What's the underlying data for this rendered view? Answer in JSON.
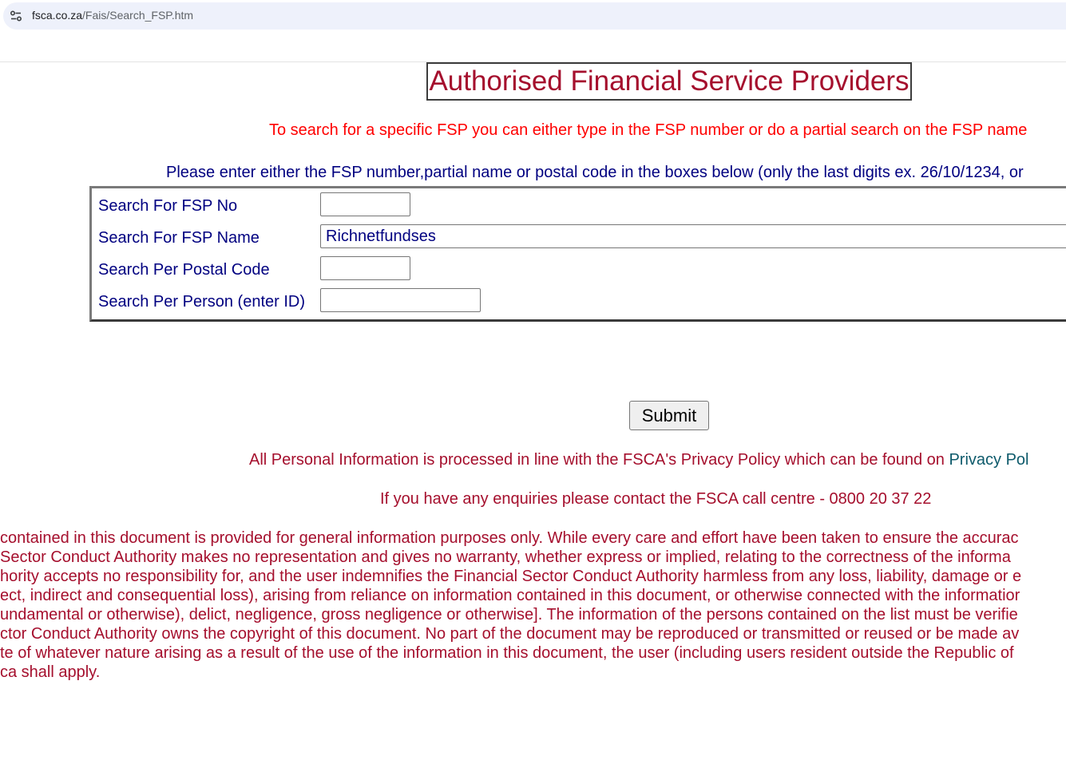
{
  "browser": {
    "url_host": "fsca.co.za",
    "url_path": "/Fais/Search_FSP.htm",
    "site_info_icon": "tune-icon"
  },
  "page": {
    "title": "Authorised Financial Service Providers",
    "instruction_red": "To search for a specific FSP you can either type in the FSP number or do a partial search on the FSP name",
    "instruction_blue": "Please enter either the FSP number,partial name or postal code in the boxes below (only the last digits ex. 26/10/1234, or"
  },
  "search_form": {
    "fsp_no": {
      "label": "Search For FSP No",
      "value": ""
    },
    "fsp_name": {
      "label": "Search For FSP Name",
      "value": "Richnetfundses"
    },
    "postal_code": {
      "label": "Search Per Postal Code",
      "value": ""
    },
    "person_id": {
      "label": "Search Per Person (enter ID)",
      "value": ""
    },
    "submit_label": "Submit"
  },
  "footer": {
    "privacy_text": "All Personal Information is processed in line with the FSCA's Privacy Policy which can be found on ",
    "privacy_link": "Privacy Pol",
    "enquiry_text": "If you have any enquiries please contact the FSCA call centre - 0800 20 37 22",
    "disclaimer_lines": [
      " contained in this document is provided for general information purposes only. While every care and effort have been taken to ensure the accurac",
      " Sector Conduct Authority makes no representation and gives no warranty, whether express or implied, relating to the correctness of the informa",
      "hority accepts no responsibility for, and the user indemnifies the Financial Sector Conduct Authority harmless from any loss, liability, damage or e",
      "ect, indirect and consequential loss), arising from reliance on information contained in this document, or otherwise connected with the informatior",
      "undamental or otherwise), delict, negligence, gross negligence or otherwise]. The information of the persons contained on the list must be verifie",
      "ctor Conduct Authority owns the copyright of this document. No part of the document may be reproduced or transmitted or reused or be made av",
      "te of whatever nature arising as a result of the use of the information in this document, the user (including users resident outside the Republic of",
      "ca shall apply."
    ]
  }
}
